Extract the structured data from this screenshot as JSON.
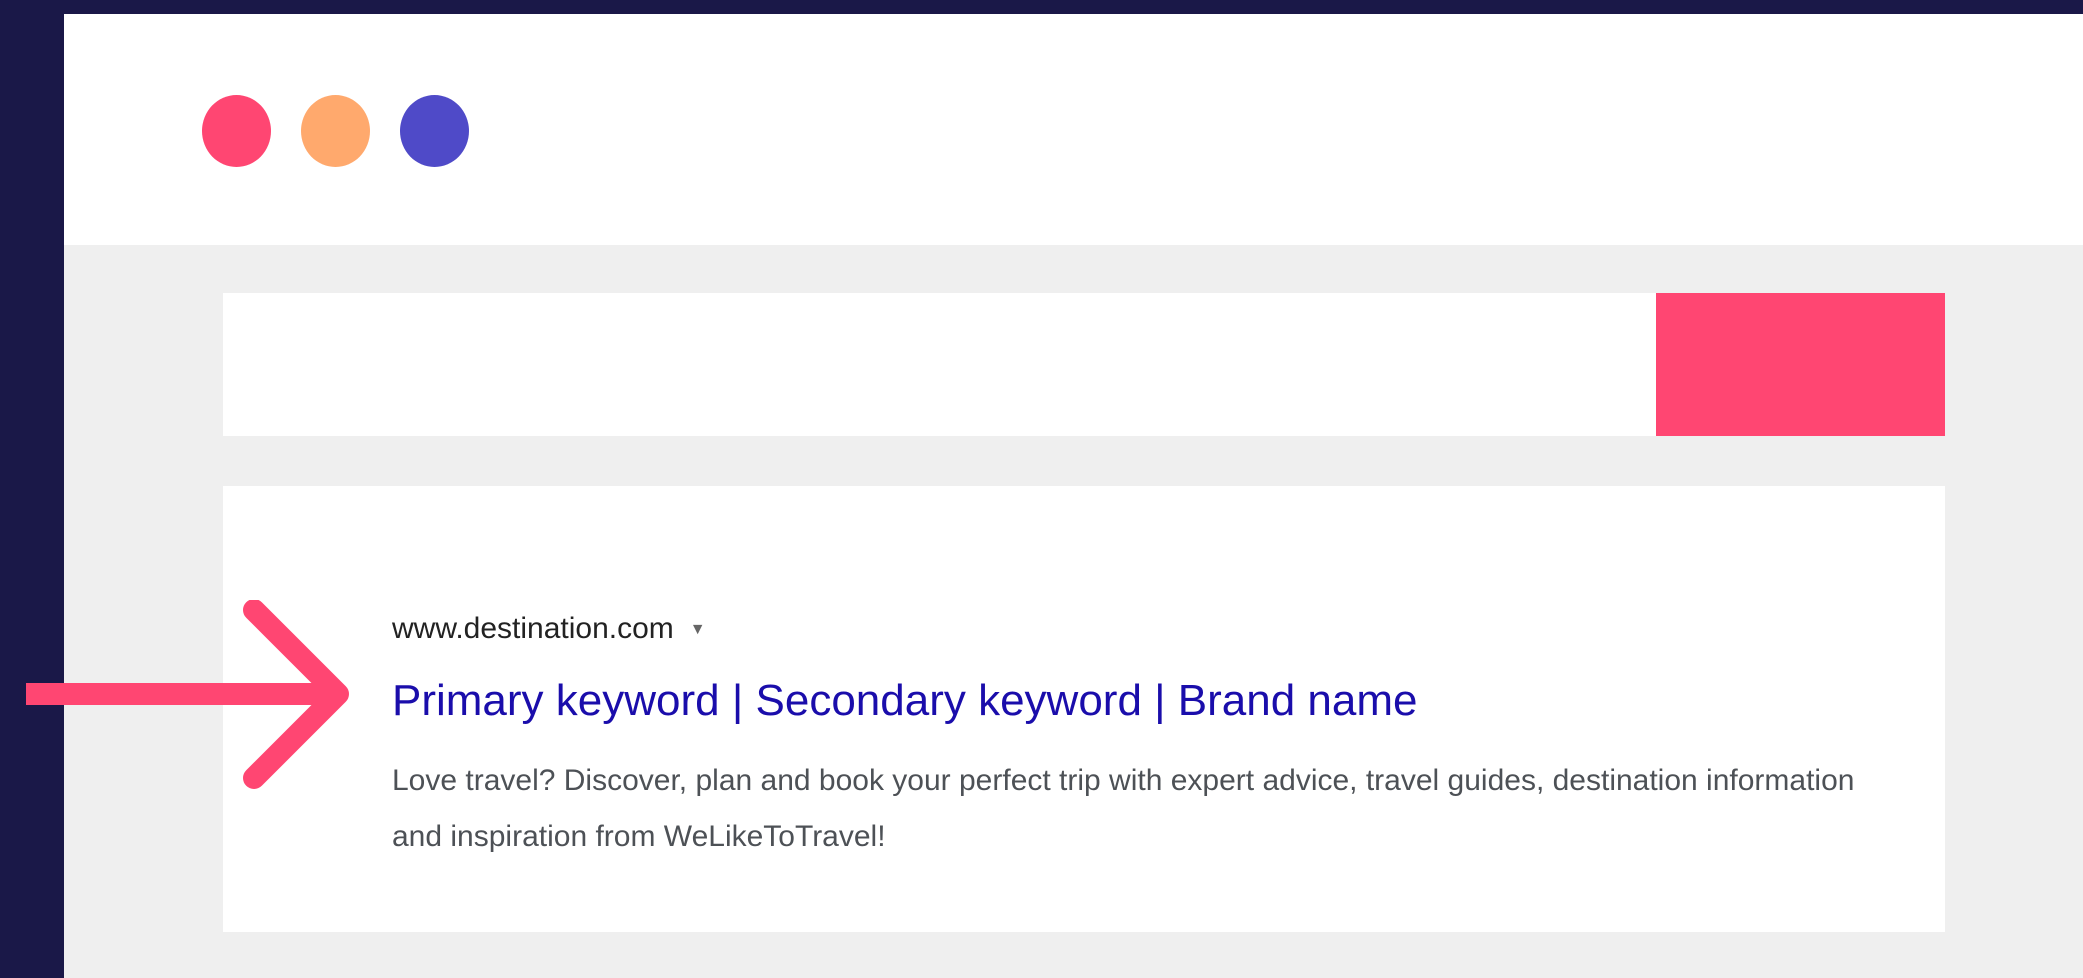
{
  "window": {
    "controls": [
      {
        "name": "close",
        "color": "#ff4672"
      },
      {
        "name": "minimize",
        "color": "#ffa96d"
      },
      {
        "name": "maximize",
        "color": "#4f4ac8"
      }
    ]
  },
  "search": {
    "button_color": "#ff4672"
  },
  "result": {
    "url": "www.destination.com",
    "title": "Primary keyword | Secondary keyword | Brand name",
    "description": "Love travel? Discover, plan and book your perfect trip with expert advice, travel guides, destination information and inspiration from WeLikeToTravel!"
  },
  "colors": {
    "background": "#1a1848",
    "accent": "#ff4672",
    "link": "#1a0dab"
  },
  "icons": {
    "pointer": "arrow-right-icon",
    "dropdown": "caret-down-icon"
  }
}
